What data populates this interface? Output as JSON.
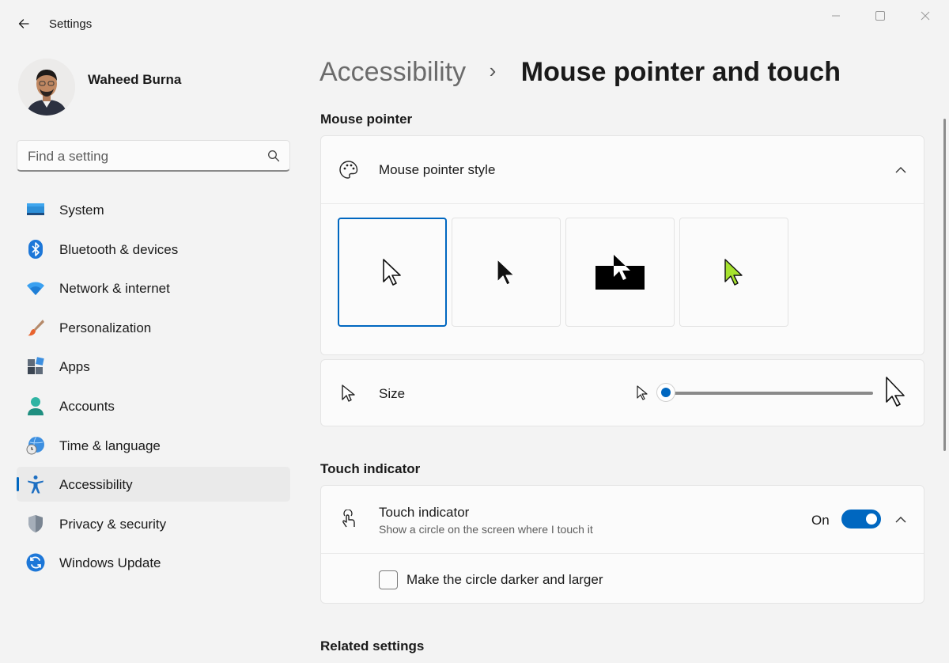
{
  "window": {
    "title": "Settings",
    "controls": [
      "minimize",
      "maximize",
      "close"
    ]
  },
  "user": {
    "name": "Waheed Burna"
  },
  "search": {
    "placeholder": "Find a setting"
  },
  "sidebar": {
    "items": [
      {
        "label": "System",
        "icon": "system-icon"
      },
      {
        "label": "Bluetooth & devices",
        "icon": "bluetooth-icon"
      },
      {
        "label": "Network & internet",
        "icon": "wifi-icon"
      },
      {
        "label": "Personalization",
        "icon": "brush-icon"
      },
      {
        "label": "Apps",
        "icon": "apps-icon"
      },
      {
        "label": "Accounts",
        "icon": "accounts-icon"
      },
      {
        "label": "Time & language",
        "icon": "time-language-icon"
      },
      {
        "label": "Accessibility",
        "icon": "accessibility-icon",
        "active": true
      },
      {
        "label": "Privacy & security",
        "icon": "shield-icon"
      },
      {
        "label": "Windows Update",
        "icon": "update-icon"
      }
    ]
  },
  "breadcrumb": {
    "parent": "Accessibility",
    "separator": "›",
    "current": "Mouse pointer and touch"
  },
  "mouse_pointer": {
    "section_title": "Mouse pointer",
    "style_label": "Mouse pointer style",
    "styles": [
      "white",
      "black",
      "inverted",
      "custom"
    ],
    "selected_style": "white",
    "custom_color": "#a6e22e",
    "size_label": "Size",
    "size_value": 0.0
  },
  "touch": {
    "section_title": "Touch indicator",
    "label": "Touch indicator",
    "description": "Show a circle on the screen where I touch it",
    "state": "On",
    "darker_label": "Make the circle darker and larger",
    "darker_checked": false
  },
  "related": {
    "section_title": "Related settings"
  },
  "colors": {
    "accent": "#0067c0",
    "background": "#f3f3f3",
    "card": "#fbfbfb"
  }
}
